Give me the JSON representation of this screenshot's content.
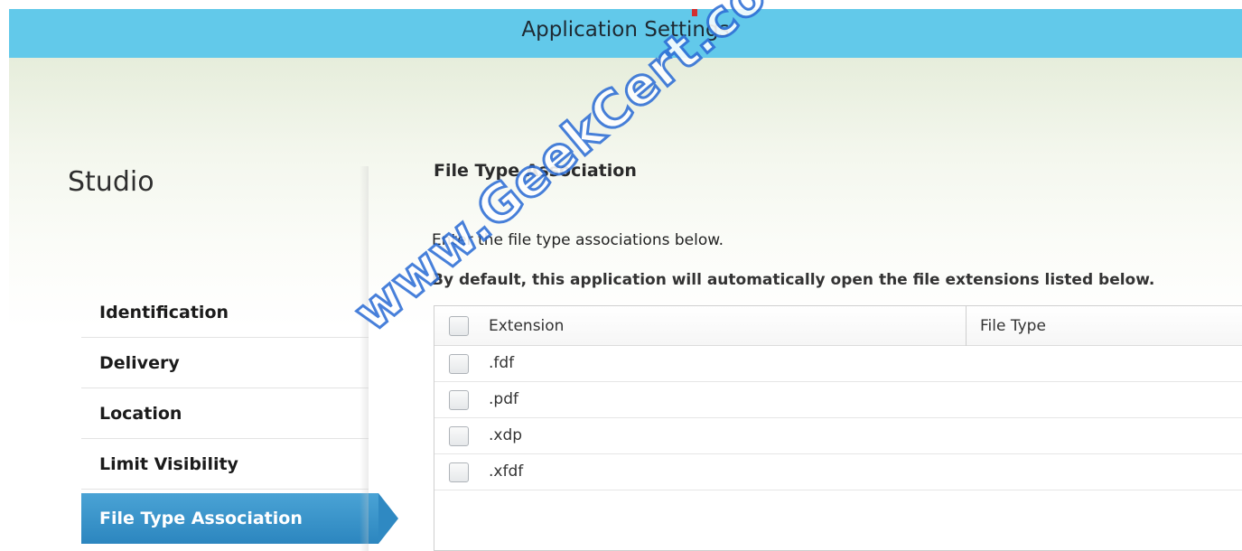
{
  "window": {
    "title": "Application Settings"
  },
  "sidebar": {
    "header": "Studio",
    "items": [
      {
        "label": "Identification",
        "active": false
      },
      {
        "label": "Delivery",
        "active": false
      },
      {
        "label": "Location",
        "active": false
      },
      {
        "label": "Limit Visibility",
        "active": false
      },
      {
        "label": "File Type Association",
        "active": true
      }
    ]
  },
  "main": {
    "section_title": "File Type Association",
    "description": "Enter the file type associations below.",
    "note": "By default, this application will automatically open the file extensions listed below.",
    "table": {
      "columns": [
        "Extension",
        "File Type"
      ],
      "rows": [
        {
          "extension": ".fdf",
          "file_type": ""
        },
        {
          "extension": ".pdf",
          "file_type": ""
        },
        {
          "extension": ".xdp",
          "file_type": ""
        },
        {
          "extension": ".xfdf",
          "file_type": ""
        }
      ]
    }
  },
  "watermark": "www.GeekCert.com",
  "colors": {
    "titlebar": "#62c9ea",
    "active_nav": "#2c86bf",
    "watermark_outline": "#2f6fd6"
  }
}
